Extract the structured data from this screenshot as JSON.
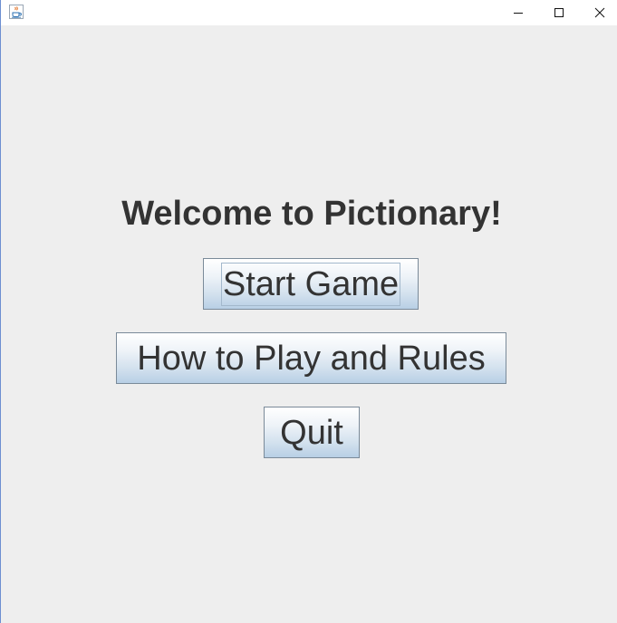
{
  "window": {
    "icon": "java-coffee-icon",
    "controls": {
      "minimize_icon": "minimize-icon",
      "maximize_icon": "maximize-icon",
      "close_icon": "close-icon"
    }
  },
  "main": {
    "title": "Welcome to Pictionary!",
    "buttons": {
      "start": "Start Game",
      "rules": "How to Play and Rules",
      "quit": "Quit"
    }
  },
  "colors": {
    "background": "#eeeeee",
    "text": "#333333",
    "button_border": "#7a8a99",
    "button_gradient_bottom": "#b8cfe5",
    "window_border": "#6d8fd1"
  }
}
